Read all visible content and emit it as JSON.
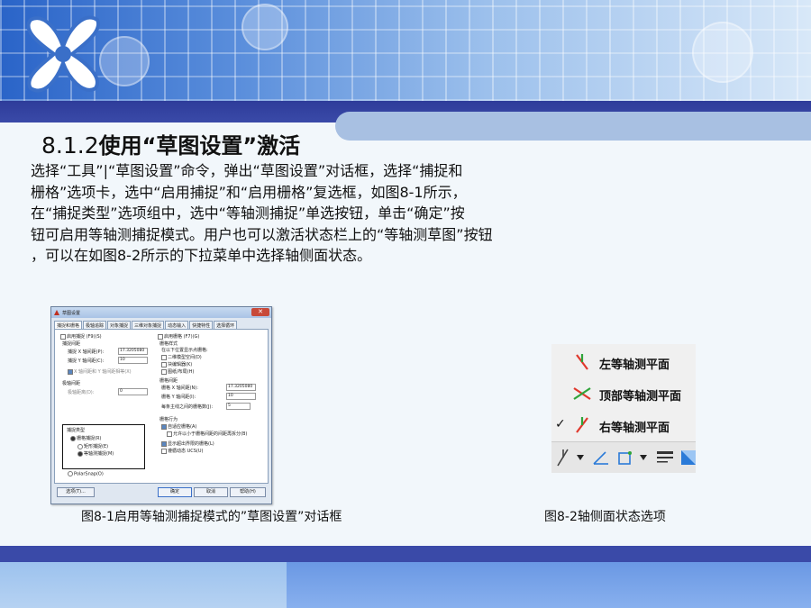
{
  "slide": {
    "title_num": "8.1.2",
    "title_text": "使用“草图设置”激活",
    "body_lines": [
      "选择“工具”|“草图设置”命令，弹出“草图设置”对话框，选择“捕捉和",
      "栅格”选项卡，选中“启用捕捉”和“启用栅格”复选框，如图8-1所示，",
      "在“捕捉类型”选项组中，选中“等轴测捕捉”单选按钮，单击“确定”按",
      "钮可启用等轴测捕捉模式。用户也可以激活状态栏上的“等轴测草图”按钮",
      "，可以在如图8-2所示的下拉菜单中选择轴侧面状态。"
    ],
    "caption_1": "图8-1启用等轴测捕捉模式的”草图设置”对话框",
    "caption_2": "图8-2轴侧面状态选项"
  },
  "dialog": {
    "title": "草图设置",
    "tabs": [
      "捕捉和栅格",
      "极轴追踪",
      "对象捕捉",
      "三维对象捕捉",
      "动态输入",
      "快捷特性",
      "选择循环"
    ],
    "snap_on": "启用捕捉 (F9)(S)",
    "snap_spacing": "捕捉间距",
    "snap_x_label": "捕捉 X 轴间距(P):",
    "snap_x_value": "17.3205080",
    "snap_y_label": "捕捉 Y 轴间距(C):",
    "snap_y_value": "10",
    "equal_xy": "X 轴间距和 Y 轴间距相等(X)",
    "polar_spacing": "极轴间距",
    "polar_dist_label": "极轴距离(D):",
    "polar_dist_value": "0",
    "snap_type": "捕捉类型",
    "grid_snap": "栅格捕捉(R)",
    "rect_snap": "矩形捕捉(E)",
    "iso_snap": "等轴测捕捉(M)",
    "polar_snap": "PolarSnap(O)",
    "grid_on": "启用栅格 (F7)(G)",
    "grid_style": "栅格样式",
    "grid_style_desc": "在以下位置显示点栅格:",
    "grid_2d": "二维模型空间(D)",
    "grid_block": "块编辑器(K)",
    "grid_sheet": "图纸/布局(H)",
    "grid_spacing": "栅格间距",
    "grid_x_label": "栅格 X 轴间距(N):",
    "grid_x_value": "17.3205080",
    "grid_y_label": "栅格 Y 轴间距(I):",
    "grid_y_value": "10",
    "major_label": "每条主线之间的栅格数(J):",
    "major_value": "5",
    "grid_behavior": "栅格行为",
    "adaptive": "自适应栅格(A)",
    "subdivide": "允许以小于栅格间距的间距再拆分(B)",
    "beyond_limits": "显示超出界限的栅格(L)",
    "follow_ucs": "遵循动态 UCS(U)",
    "options_btn": "选项(T)...",
    "ok_btn": "确定",
    "cancel_btn": "取消",
    "help_btn": "帮助(H)"
  },
  "menu": {
    "items": [
      "左等轴测平面",
      "顶部等轴测平面",
      "右等轴测平面"
    ],
    "checked_index": 2,
    "check_mark": "✓"
  },
  "colors": {
    "iso_red": "#e0382c",
    "iso_green": "#2fa43a",
    "toolbar_blue": "#2a7ad8"
  }
}
